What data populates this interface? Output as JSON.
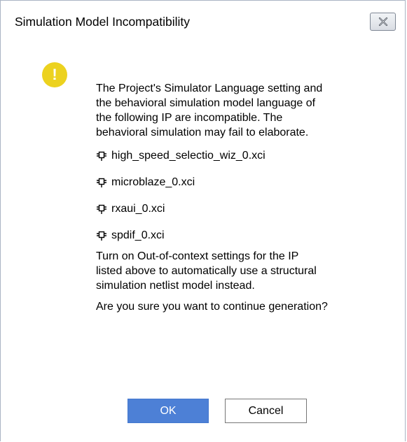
{
  "window": {
    "title": "Simulation Model Incompatibility",
    "close_icon": "close-icon"
  },
  "message": {
    "icon": "warning-icon",
    "icon_glyph": "!",
    "icon_color": "#ecd21f",
    "intro_lines": [
      "The Project's Simulator Language setting and",
      "the behavioral simulation model language of",
      "the following IP are incompatible. The",
      "behavioral simulation may fail to elaborate."
    ],
    "ip_items": [
      "high_speed_selectio_wiz_0.xci",
      "microblaze_0.xci",
      "rxaui_0.xci",
      "spdif_0.xci"
    ],
    "advice_lines": [
      "Turn on Out-of-context settings for the IP",
      "listed above to automatically use a structural",
      "simulation netlist model instead."
    ],
    "question": "Are you sure you want to continue generation?"
  },
  "buttons": {
    "ok_label": "OK",
    "cancel_label": "Cancel",
    "ok_color": "#4d80d6"
  }
}
